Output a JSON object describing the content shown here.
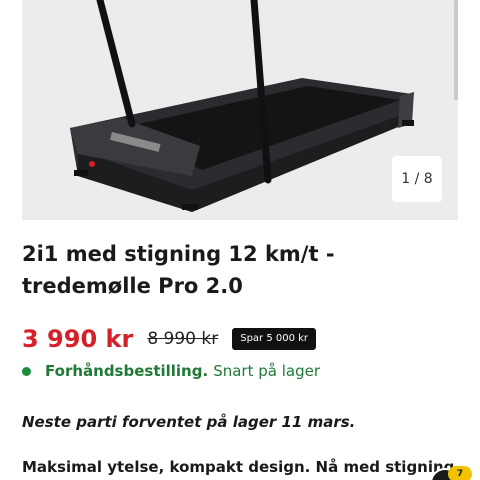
{
  "gallery": {
    "counter": "1 / 8",
    "image_alt": "treadmill-image"
  },
  "product": {
    "title": "2i1 med stigning 12 km/t - tredemølle Pro 2.0",
    "price": "3 990 kr",
    "old_price": "8 990 kr",
    "save_badge": "Spar 5 000 kr",
    "stock_status": "Forhåndsbestilling.",
    "stock_note": "Snart på lager",
    "notice": "Neste parti forventet på lager 11 mars.",
    "tagline": "Maksimal ytelse, kompakt design. Nå med stigning."
  },
  "chat": {
    "badge": "7"
  },
  "colors": {
    "price": "#d5202a",
    "stock": "#1e8a3c",
    "badge_bg": "#111111",
    "hero_bg": "#ececec"
  }
}
